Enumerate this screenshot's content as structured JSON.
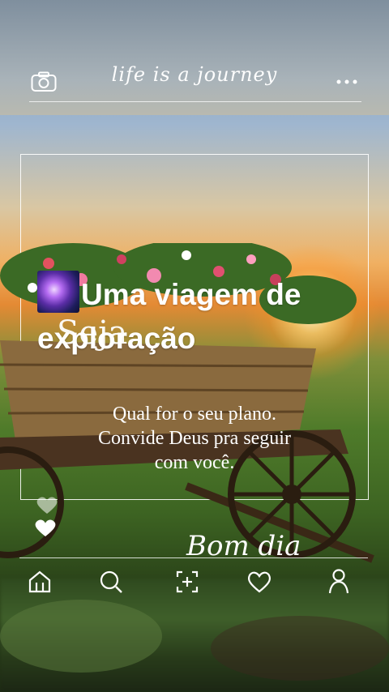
{
  "header": {
    "brand": "life is a journey",
    "camera_icon": "camera-icon",
    "more_icon": "more-dots-icon"
  },
  "post": {
    "headline": "Uma viagem de exploração",
    "headline_emoji": "milky-way-emoji",
    "overlay_word": "Seja",
    "message_lines": [
      "Qual for o  seu plano.",
      "Convide Deus pra seguir",
      "com você."
    ],
    "signature": "Bom dia"
  },
  "nav": {
    "items": [
      "home-icon",
      "search-icon",
      "create-icon",
      "heart-icon",
      "profile-icon"
    ]
  },
  "colors": {
    "sunset": "#e48a34",
    "grass": "#4f7b2a",
    "text": "#ffffff"
  }
}
